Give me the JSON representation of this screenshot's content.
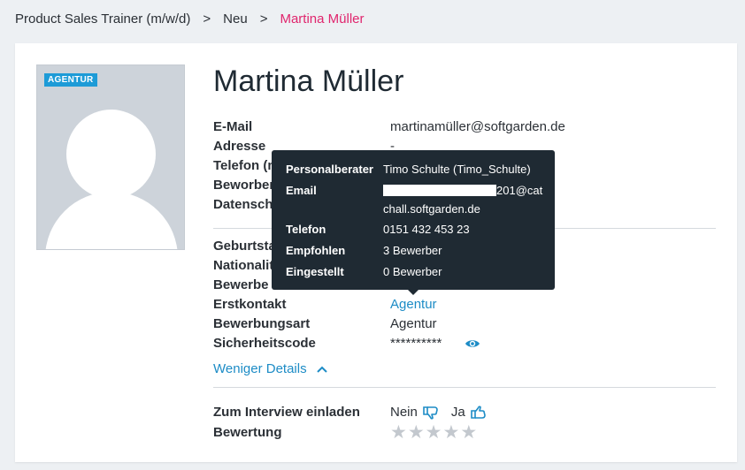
{
  "breadcrumb": {
    "job": "Product Sales Trainer (m/w/d)",
    "sep1": ">",
    "stage": "Neu",
    "sep2": ">",
    "candidate": "Martina Müller"
  },
  "profile": {
    "badge": "AGENTUR",
    "name": "Martina Müller"
  },
  "fields": {
    "email_label": "E-Mail",
    "email_value": "martinamüller@softgarden.de",
    "address_label": "Adresse",
    "address_value": "-",
    "phone_label": "Telefon (m",
    "applied_label": "Beworben",
    "privacy_label": "Datenschu",
    "birth_label": "Geburtsta",
    "nationality_label": "Nationalit",
    "applied2_label": "Bewerbe",
    "first_contact_label": "Erstkontakt",
    "first_contact_value": "Agentur",
    "application_type_label": "Bewerbungsart",
    "application_type_value": "Agentur",
    "security_label": "Sicherheitscode",
    "security_value": "**********"
  },
  "less_details": "Weniger Details",
  "interview": {
    "label": "Zum Interview einladen",
    "no": "Nein",
    "yes": "Ja"
  },
  "rating": {
    "label": "Bewertung",
    "stars": 0,
    "max": 5
  },
  "tooltip": {
    "advisor_label": "Personalberater",
    "advisor_value": "Timo Schulte (Timo_Schulte)",
    "email_label": "Email",
    "email_value_suffix": "201@cat",
    "email_value_line2": "chall.softgarden.de",
    "phone_label": "Telefon",
    "phone_value": "0151 432 453 23",
    "recommended_label": "Empfohlen",
    "recommended_value": "3 Bewerber",
    "hired_label": "Eingestellt",
    "hired_value": "0 Bewerber"
  },
  "colors": {
    "accent": "#1d8cc6",
    "breadcrumb_active": "#e0256d",
    "badge": "#1d9bd7",
    "tooltip_bg": "#1f2a33"
  }
}
